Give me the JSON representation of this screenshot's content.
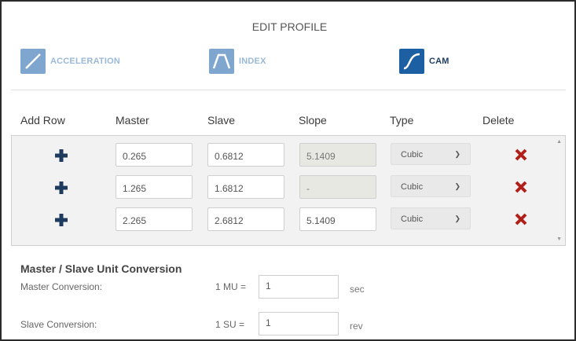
{
  "title": "EDIT PROFILE",
  "modes": [
    {
      "label": "ACCELERATION",
      "active": false,
      "icon": "ramp-icon"
    },
    {
      "label": "INDEX",
      "active": false,
      "icon": "trapezoid-icon"
    },
    {
      "label": "CAM",
      "active": true,
      "icon": "s-curve-icon"
    }
  ],
  "table": {
    "headers": {
      "add_row": "Add Row",
      "master": "Master",
      "slave": "Slave",
      "slope": "Slope",
      "type": "Type",
      "delete": "Delete"
    },
    "rows": [
      {
        "master": "0.265",
        "slave": "0.6812",
        "slope": "5.1409",
        "slope_readonly": true,
        "type": "Cubic"
      },
      {
        "master": "1.265",
        "slave": "1.6812",
        "slope": "-",
        "slope_readonly": true,
        "type": "Cubic"
      },
      {
        "master": "2.265",
        "slave": "2.6812",
        "slope": "5.1409",
        "slope_readonly": false,
        "type": "Cubic"
      }
    ]
  },
  "conversion": {
    "title": "Master / Slave Unit Conversion",
    "master": {
      "label": "Master Conversion:",
      "unit": "1 MU =",
      "value": "1",
      "suffix": "sec"
    },
    "slave": {
      "label": "Slave Conversion:",
      "unit": "1 SU =",
      "value": "1",
      "suffix": "rev"
    }
  },
  "colors": {
    "accent": "#1d5fa3",
    "inactive_icon": "#7fa6cf",
    "add_icon": "#1f3a5f",
    "delete_icon": "#b0201a"
  }
}
